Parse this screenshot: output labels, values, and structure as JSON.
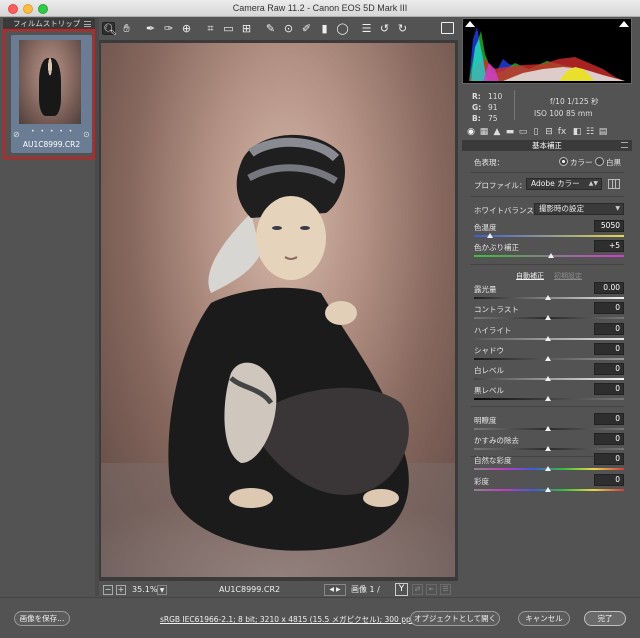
{
  "window": {
    "title": "Camera Raw 11.2  -  Canon EOS 5D Mark III"
  },
  "filmstrip": {
    "header": "フィルムストリップ",
    "filename": "AU1C8999.CR2",
    "dots": "• • • • •"
  },
  "toolbar": {
    "tools": [
      "zoom-icon",
      "hand-icon",
      "white-balance-icon",
      "color-sampler-icon",
      "target-adjust-icon",
      "crop-icon",
      "straighten-icon",
      "transform-icon",
      "spot-removal-icon",
      "red-eye-icon",
      "adjustment-brush-icon",
      "graduated-filter-icon",
      "radial-filter-icon",
      "preferences-icon",
      "rotate-ccw-icon",
      "rotate-cw-icon"
    ]
  },
  "image_bar": {
    "zoom": "35.1%",
    "filename": "AU1C8999.CR2",
    "count": "画像 1 / 1",
    "y_label": "Y"
  },
  "readout": {
    "r_label": "R:",
    "r_value": "110",
    "g_label": "G:",
    "g_value": "91",
    "b_label": "B:",
    "b_value": "75",
    "aperture_shutter": "f/10   1/125 秒",
    "iso_focal": "ISO 100   85 mm"
  },
  "panel": {
    "title": "基本補正",
    "treatment_label": "色表現：",
    "treatment_color": "カラー",
    "treatment_bw": "白黒",
    "profile_label": "プロファイル：",
    "profile_value": "Adobe カラー",
    "wb_label": "ホワイトバランス：",
    "wb_value": "撮影時の設定",
    "temp_label": "色温度",
    "temp_value": "5050",
    "tint_label": "色かぶり補正",
    "tint_value": "+5",
    "auto_link": "自動補正",
    "default_link": "初期設定",
    "exposure_label": "露光量",
    "exposure_value": "0.00",
    "contrast_label": "コントラスト",
    "contrast_value": "0",
    "highlights_label": "ハイライト",
    "highlights_value": "0",
    "shadows_label": "シャドウ",
    "shadows_value": "0",
    "whites_label": "白レベル",
    "whites_value": "0",
    "blacks_label": "黒レベル",
    "blacks_value": "0",
    "clarity_label": "明瞭度",
    "clarity_value": "0",
    "dehaze_label": "かすみの除去",
    "dehaze_value": "0",
    "vibrance_label": "自然な彩度",
    "vibrance_value": "0",
    "saturation_label": "彩度",
    "saturation_value": "0"
  },
  "bottom": {
    "save_label": "画像を保存...",
    "workflow": "sRGB IEC61966-2.1; 8 bit; 3210 x 4815 (15.5 メガピクセル); 300 ppi",
    "open_object_label": "オブジェクトとして開く",
    "cancel_label": "キャンセル",
    "done_label": "完了"
  },
  "colors": {
    "selection_outline": "#cc1f1f",
    "panel_bg": "#535353",
    "title_bg": "#3a3a3a"
  }
}
